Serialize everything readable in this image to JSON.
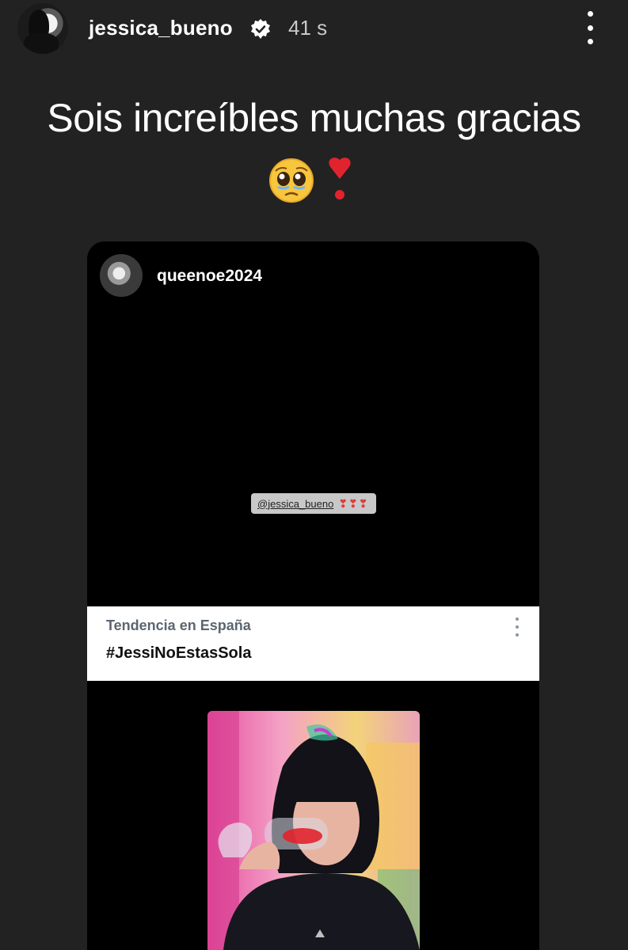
{
  "story": {
    "username": "jessica_bueno",
    "time": "41 s",
    "caption": "Sois increíbles muchas gracias",
    "caption_emojis": [
      "pleading-face-emoji",
      "heart-exclamation-emoji"
    ]
  },
  "shared_post": {
    "username": "queenoe2024",
    "mention_sticker": "@jessica_bueno",
    "mention_hearts": "❣❣❣",
    "trend": {
      "label": "Tendencia en España",
      "hashtag": "#JessiNoEstasSola"
    }
  },
  "colors": {
    "background": "#222222",
    "card": "#000000",
    "text": "#ffffff"
  }
}
